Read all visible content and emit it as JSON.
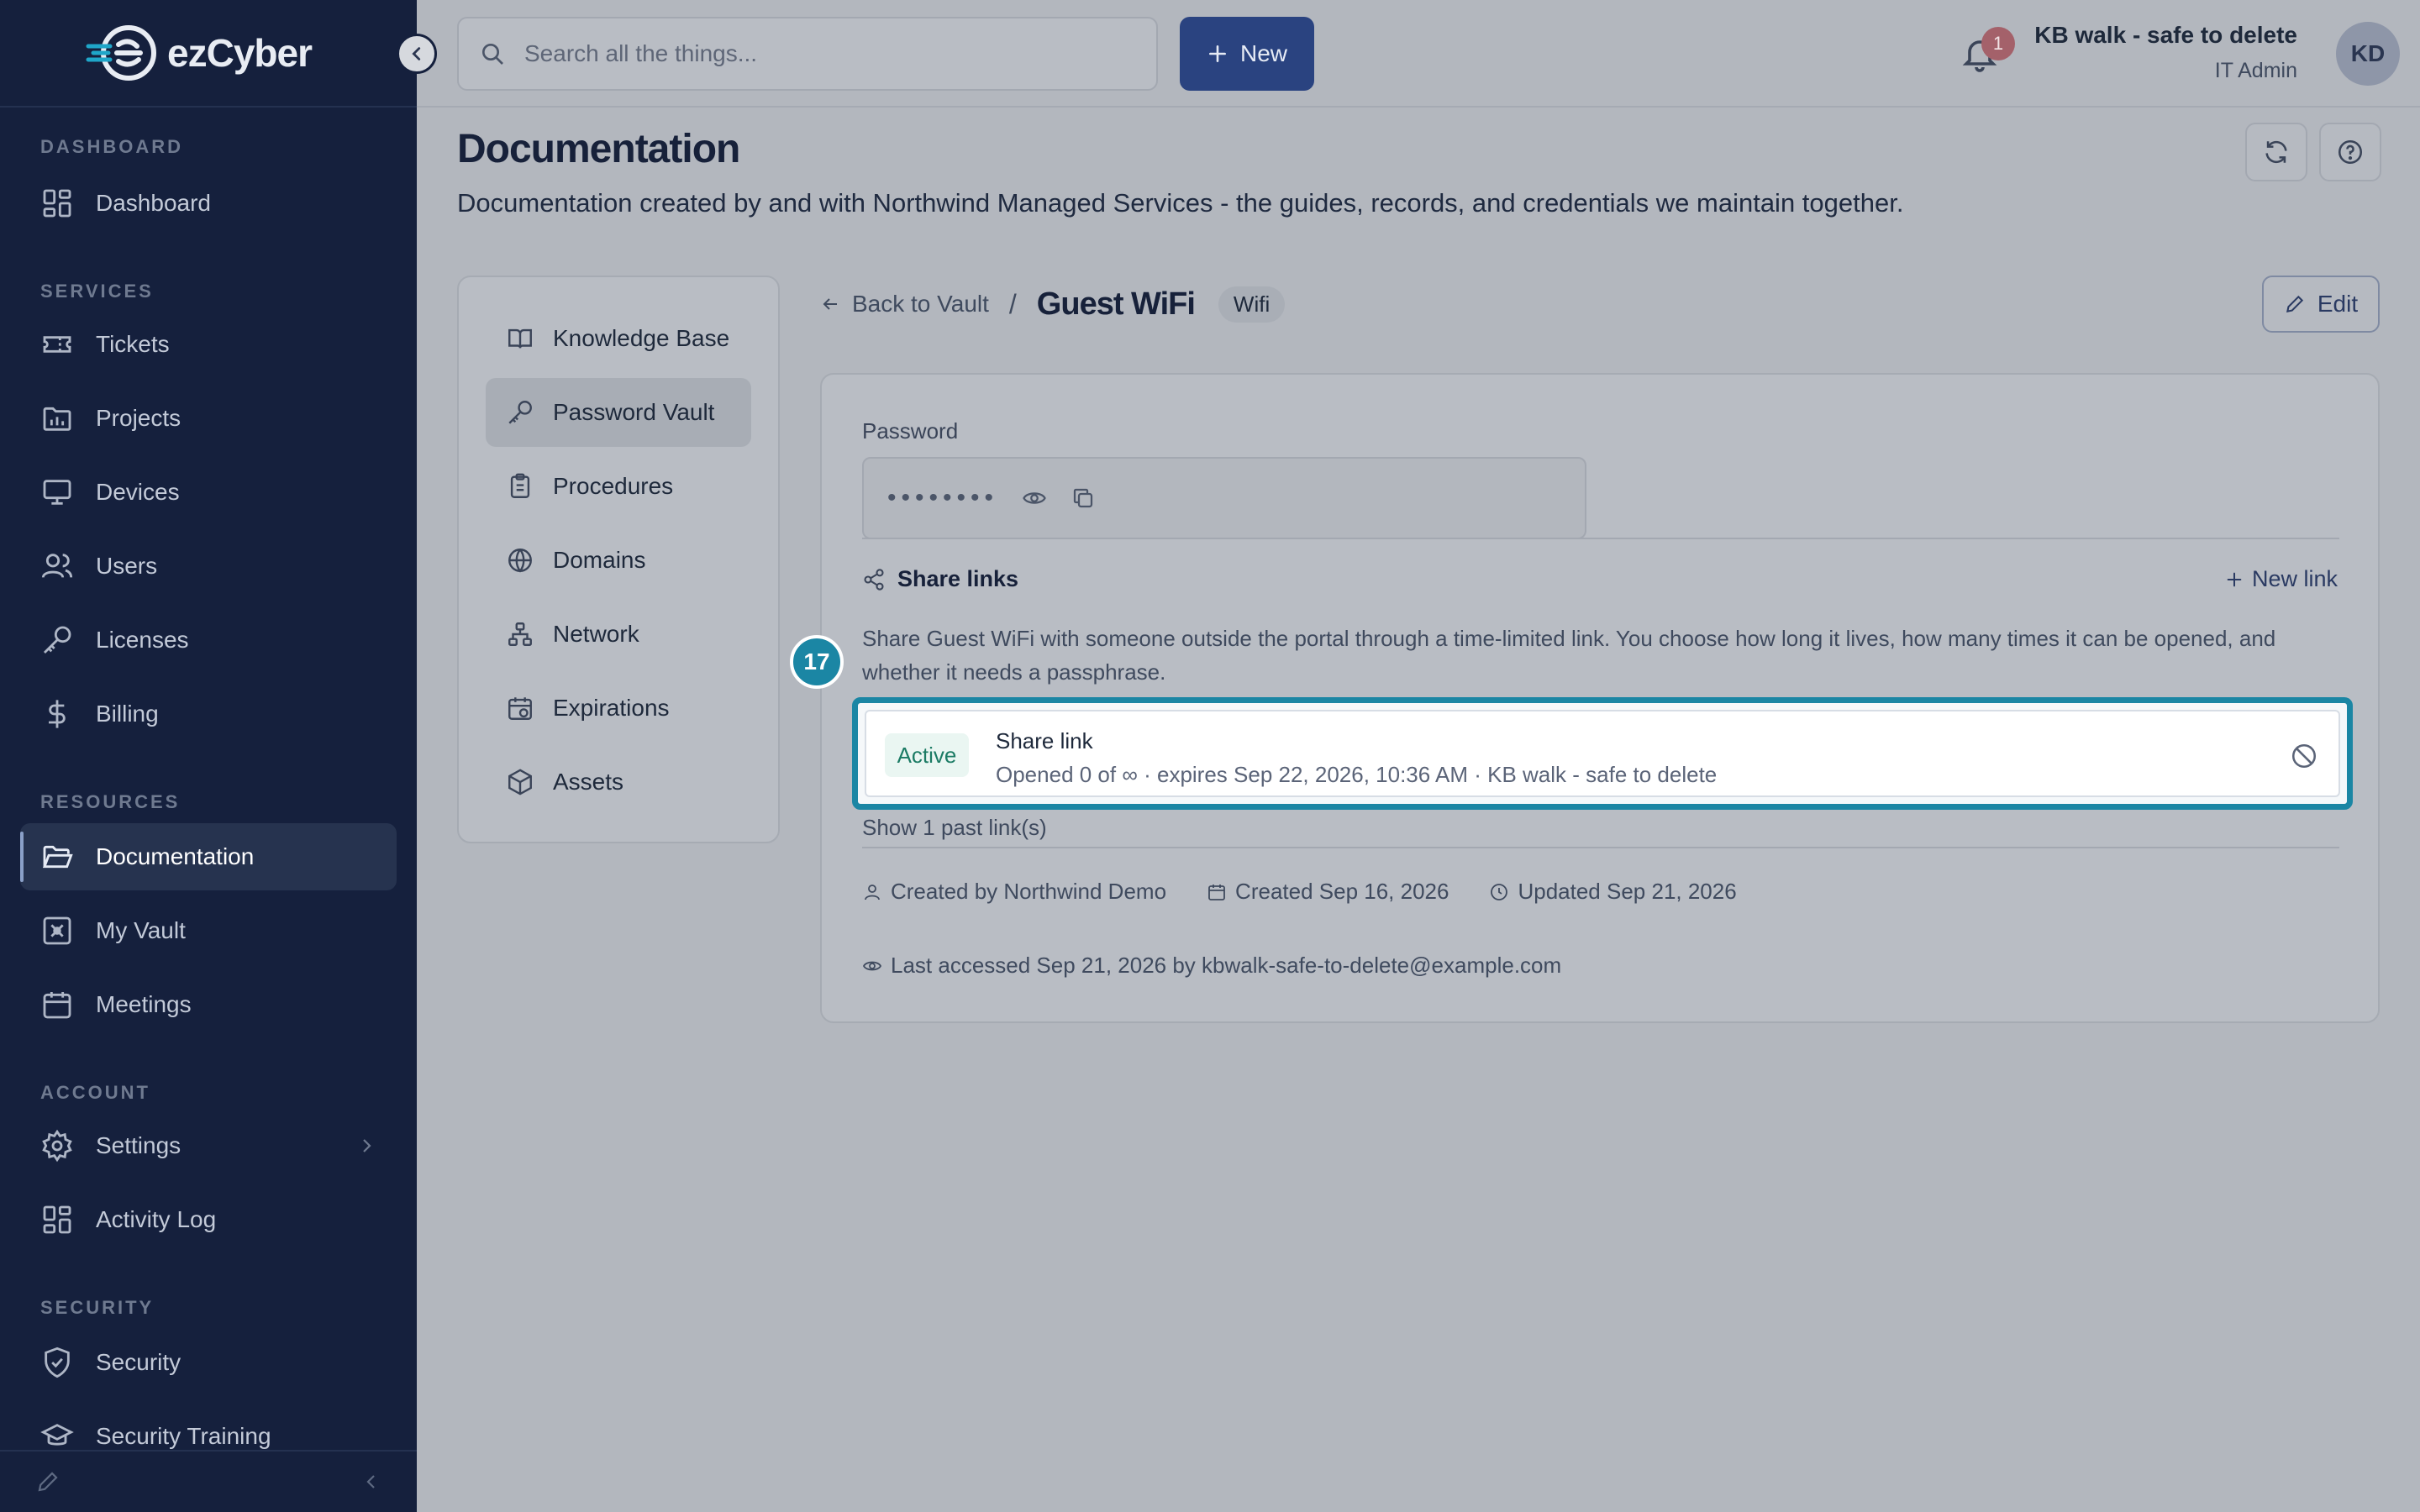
{
  "brand": {
    "name_part1": "ez",
    "name_part2": "Cyber",
    "accent": "#1b86a4",
    "sidebar_bg": "#15203d"
  },
  "sidebar": {
    "sections": [
      {
        "label": "DASHBOARD",
        "items": [
          {
            "label": "Dashboard",
            "icon": "grid-icon"
          }
        ]
      },
      {
        "label": "SERVICES",
        "items": [
          {
            "label": "Tickets",
            "icon": "ticket-icon"
          },
          {
            "label": "Projects",
            "icon": "chart-folder-icon"
          },
          {
            "label": "Devices",
            "icon": "monitor-icon"
          },
          {
            "label": "Users",
            "icon": "users-icon"
          },
          {
            "label": "Licenses",
            "icon": "key-icon"
          },
          {
            "label": "Billing",
            "icon": "dollar-icon"
          }
        ]
      },
      {
        "label": "RESOURCES",
        "items": [
          {
            "label": "Documentation",
            "icon": "folder-open-icon",
            "active": true
          },
          {
            "label": "My Vault",
            "icon": "vault-icon"
          },
          {
            "label": "Meetings",
            "icon": "calendar-icon"
          }
        ]
      },
      {
        "label": "ACCOUNT",
        "items": [
          {
            "label": "Settings",
            "icon": "gear-icon"
          },
          {
            "label": "Activity Log",
            "icon": "grid-icon"
          }
        ]
      },
      {
        "label": "SECURITY",
        "items": [
          {
            "label": "Security",
            "icon": "shield-icon"
          },
          {
            "label": "Security Training",
            "icon": "graduation-cap-icon"
          }
        ]
      }
    ]
  },
  "topbar": {
    "search_placeholder": "Search all the things...",
    "new_label": "New",
    "notification_count": "1",
    "user_name": "KB walk - safe to delete",
    "user_role": "IT Admin",
    "avatar_initials": "KD"
  },
  "page": {
    "title": "Documentation",
    "subtitle": "Documentation created by and with Northwind Managed Services - the guides, records, and credentials we maintain together."
  },
  "docnav": [
    {
      "label": "Knowledge Base",
      "icon": "book-icon"
    },
    {
      "label": "Password Vault",
      "icon": "key-icon",
      "active": true
    },
    {
      "label": "Procedures",
      "icon": "clipboard-icon"
    },
    {
      "label": "Domains",
      "icon": "globe-icon"
    },
    {
      "label": "Network",
      "icon": "network-icon"
    },
    {
      "label": "Expirations",
      "icon": "calendar-clock-icon"
    },
    {
      "label": "Assets",
      "icon": "box-icon"
    }
  ],
  "breadcrumb": {
    "back_label": "Back to Vault",
    "separator": "/",
    "title": "Guest WiFi",
    "badge": "Wifi"
  },
  "edit_label": "Edit",
  "entry": {
    "password_label": "Password",
    "password_masked": "••••••••",
    "share_links_title": "Share links",
    "new_link_label": "New link",
    "share_desc": "Share Guest WiFi with someone outside the portal through a time-limited link. You choose how long it lives, how many times it can be opened, and whether it needs a passphrase.",
    "link": {
      "status": "Active",
      "title": "Share link",
      "meta": "Opened 0 of ∞ · expires Sep 22, 2026, 10:36 AM · KB walk - safe to delete"
    },
    "past_links_label": "Show 1 past link(s)",
    "created_by": "Created by Northwind Demo",
    "created_on": "Created Sep 16, 2026",
    "updated_on": "Updated Sep 21, 2026",
    "last_accessed": "Last accessed Sep 21, 2026 by kbwalk-safe-to-delete@example.com"
  },
  "tour_step": "17"
}
